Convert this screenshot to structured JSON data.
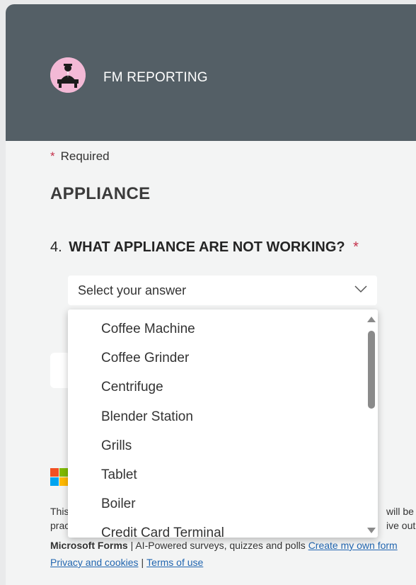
{
  "header": {
    "brand": "FM REPORTING",
    "logo_icon": "avatar-logo"
  },
  "form": {
    "required_star": "*",
    "required_label": "Required",
    "section_title": "APPLIANCE",
    "question": {
      "number": "4.",
      "text": "WHAT APPLIANCE ARE NOT WORKING?",
      "required_star": "*"
    },
    "select": {
      "value": "Select your answer",
      "icon": "chevron-down-icon"
    }
  },
  "dropdown": {
    "options": [
      "Coffee Machine",
      "Coffee Grinder",
      "Centrifuge",
      "Blender Station",
      "Grills",
      "Tablet",
      "Boiler",
      "Credit Card Terminal"
    ]
  },
  "footer": {
    "disclaimer_start_1": "This",
    "disclaimer_start_2": "prac",
    "disclaimer_end_1": "will be s",
    "disclaimer_end_2": "ive out y",
    "product": "Microsoft Forms",
    "separator": "|",
    "tagline": "AI-Powered surveys, quizzes and polls",
    "create_link": "Create my own form",
    "privacy_link": "Privacy and cookies",
    "terms_link": "Terms of use"
  },
  "colors": {
    "header_bg": "#545f66",
    "required_red": "#c4314b",
    "link_blue": "#2266b0"
  }
}
